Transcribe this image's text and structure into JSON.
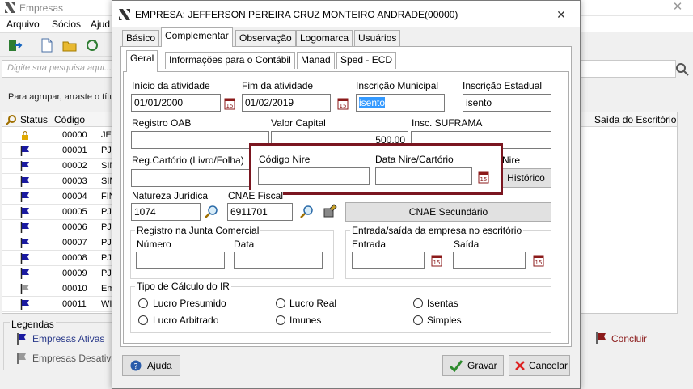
{
  "background": {
    "window_title": "Empresas",
    "menu": [
      "Arquivo",
      "Sócios",
      "Ajud"
    ],
    "search_placeholder": "Digite sua pesquisa aqui...",
    "group_hint": "Para agrupar, arraste o títu",
    "columns": {
      "status": "Status",
      "codigo": "Código",
      "saida": "Saída do Escritório"
    },
    "rows": [
      {
        "code": "00000",
        "name": "JE",
        "flag": "locked"
      },
      {
        "code": "00001",
        "name": "PJ",
        "flag": "blue"
      },
      {
        "code": "00002",
        "name": "SIN",
        "flag": "blue"
      },
      {
        "code": "00003",
        "name": "SIN",
        "flag": "blue"
      },
      {
        "code": "00004",
        "name": "FIN",
        "flag": "blue"
      },
      {
        "code": "00005",
        "name": "PJ",
        "flag": "blue"
      },
      {
        "code": "00006",
        "name": "PJ",
        "flag": "blue"
      },
      {
        "code": "00007",
        "name": "PJ",
        "flag": "blue"
      },
      {
        "code": "00008",
        "name": "PJ",
        "flag": "blue"
      },
      {
        "code": "00009",
        "name": "PJ",
        "flag": "blue"
      },
      {
        "code": "00010",
        "name": "Em",
        "flag": "gray"
      },
      {
        "code": "00011",
        "name": "WI",
        "flag": "blue"
      }
    ],
    "legend_title": "Legendas",
    "legend_active": "Empresas Ativas",
    "legend_inactive": "Empresas Desativad",
    "concluir": "Concluir"
  },
  "dialog": {
    "title": "EMPRESA: JEFFERSON PEREIRA CRUZ MONTEIRO ANDRADE(00000)",
    "main_tabs": [
      "Básico",
      "Complementar",
      "Observação",
      "Logomarca",
      "Usuários"
    ],
    "sub_tabs": [
      "Geral",
      "Informações para o Contábil",
      "Manad",
      "Sped - ECD"
    ],
    "inicio_atividade": {
      "label": "Início da atividade",
      "value": "01/01/2000"
    },
    "fim_atividade": {
      "label": "Fim da atividade",
      "value": "01/02/2019"
    },
    "inscricao_municipal": {
      "label": "Inscrição Municipal",
      "value": "isento"
    },
    "inscricao_estadual": {
      "label": "Inscrição Estadual",
      "value": "isento"
    },
    "registro_oab": {
      "label": "Registro OAB",
      "value": ""
    },
    "valor_capital": {
      "label": "Valor Capital",
      "value": "500,00"
    },
    "insc_suframa": {
      "label": "Insc. SUFRAMA",
      "value": ""
    },
    "reg_cartorio": {
      "label": "Reg.Cartório (Livro/Folha)",
      "value": ""
    },
    "codigo_nire": {
      "label": "Código Nire",
      "value": ""
    },
    "data_nire": {
      "label": "Data Nire/Cartório",
      "value": ""
    },
    "nire_partial": "Nire",
    "historico_btn": "Histórico",
    "natureza_juridica": {
      "label": "Natureza Jurídica",
      "value": "1074"
    },
    "cnae_fiscal": {
      "label": "CNAE Fiscal",
      "value": "6911701"
    },
    "cnae_secundario_btn": "CNAE Secundário",
    "registro_junta": {
      "title": "Registro na Junta Comercial",
      "numero_label": "Número",
      "data_label": "Data"
    },
    "entrada_saida": {
      "title": "Entrada/saída da empresa no escritório",
      "entrada_label": "Entrada",
      "saida_label": "Saída"
    },
    "tipo_calculo": {
      "title": "Tipo de Cálculo do IR",
      "options": [
        "Lucro Presumido",
        "Lucro Real",
        "Isentas",
        "Lucro Arbitrado",
        "Imunes",
        "Simples"
      ]
    },
    "ajuda_btn": "Ajuda",
    "gravar_btn": "Gravar",
    "cancelar_btn": "Cancelar"
  },
  "colors": {
    "highlight_border": "#7a1620",
    "selection": "#3399ff",
    "flag_blue": "#1a1aa0"
  }
}
